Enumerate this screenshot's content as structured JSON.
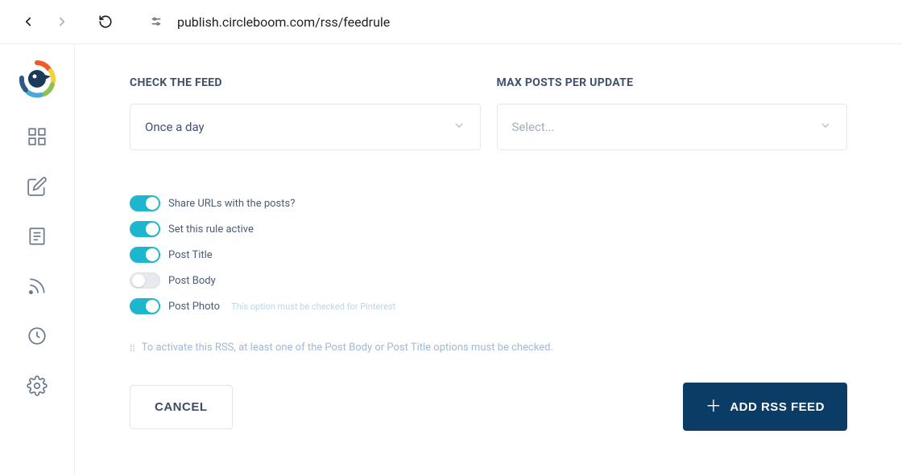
{
  "browser": {
    "url": "publish.circleboom.com/rss/feedrule"
  },
  "form": {
    "check_feed": {
      "label": "CHECK THE FEED",
      "value": "Once a day"
    },
    "max_posts": {
      "label": "MAX POSTS PER UPDATE",
      "placeholder": "Select..."
    }
  },
  "toggles": [
    {
      "label": "Share URLs with the posts?",
      "on": true,
      "hint": ""
    },
    {
      "label": "Set this rule active",
      "on": true,
      "hint": ""
    },
    {
      "label": "Post Title",
      "on": true,
      "hint": ""
    },
    {
      "label": "Post Body",
      "on": false,
      "hint": ""
    },
    {
      "label": "Post Photo",
      "on": true,
      "hint": "This option must be checked for Pinterest"
    }
  ],
  "note": "To activate this RSS, at least one of the Post Body or Post Title options must be checked.",
  "actions": {
    "cancel": "CANCEL",
    "primary": "ADD RSS FEED"
  }
}
